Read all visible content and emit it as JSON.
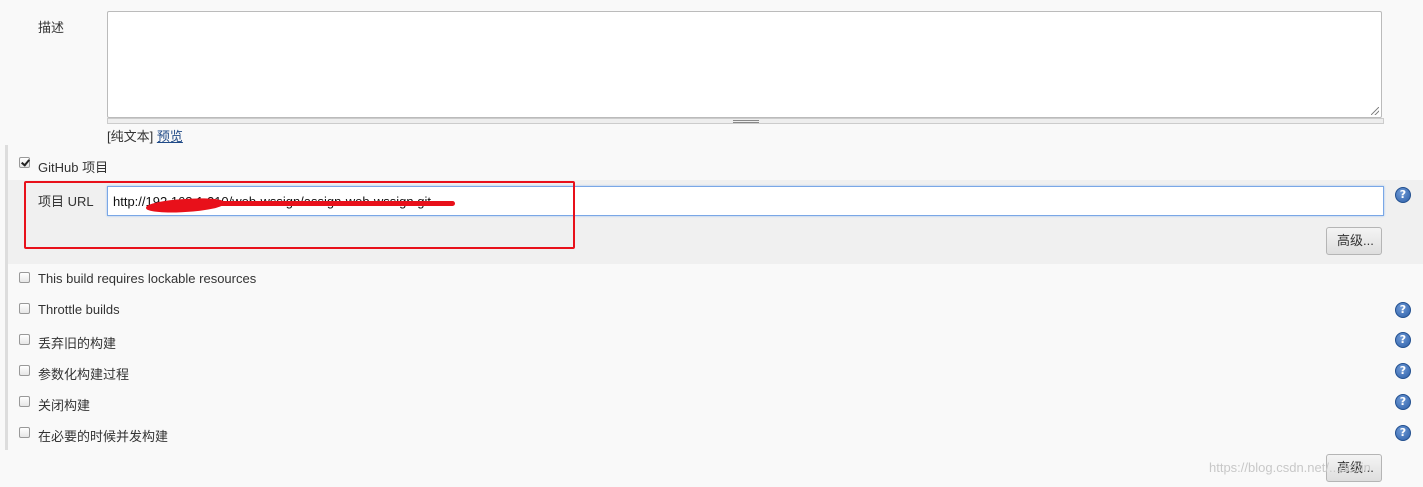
{
  "description": {
    "label": "描述",
    "value": "",
    "plain_text_label": "[纯文本]",
    "preview_link": "预览"
  },
  "github_project": {
    "label": "GitHub 项目",
    "checked": true,
    "url_label": "项目 URL",
    "url_value": "http://192.168.1.210/web-wssign/assign-web-wssign.git",
    "advanced_button": "高级..."
  },
  "options": [
    {
      "label": "This build requires lockable resources",
      "checked": false,
      "has_help": false
    },
    {
      "label": "Throttle builds",
      "checked": false,
      "has_help": true
    },
    {
      "label": "丢弃旧的构建",
      "checked": false,
      "has_help": true
    },
    {
      "label": "参数化构建过程",
      "checked": false,
      "has_help": true
    },
    {
      "label": "关闭构建",
      "checked": false,
      "has_help": true
    },
    {
      "label": "在必要的时候并发构建",
      "checked": false,
      "has_help": true
    }
  ],
  "bottom_advanced_button": "高级...",
  "help_icon": "question-circle-icon",
  "watermark": "https://blog.csdn.net/...dcbin",
  "colors": {
    "annotation_red": "#e8101a",
    "link_blue": "#204a87",
    "help_blue": "#2d5fa8"
  }
}
